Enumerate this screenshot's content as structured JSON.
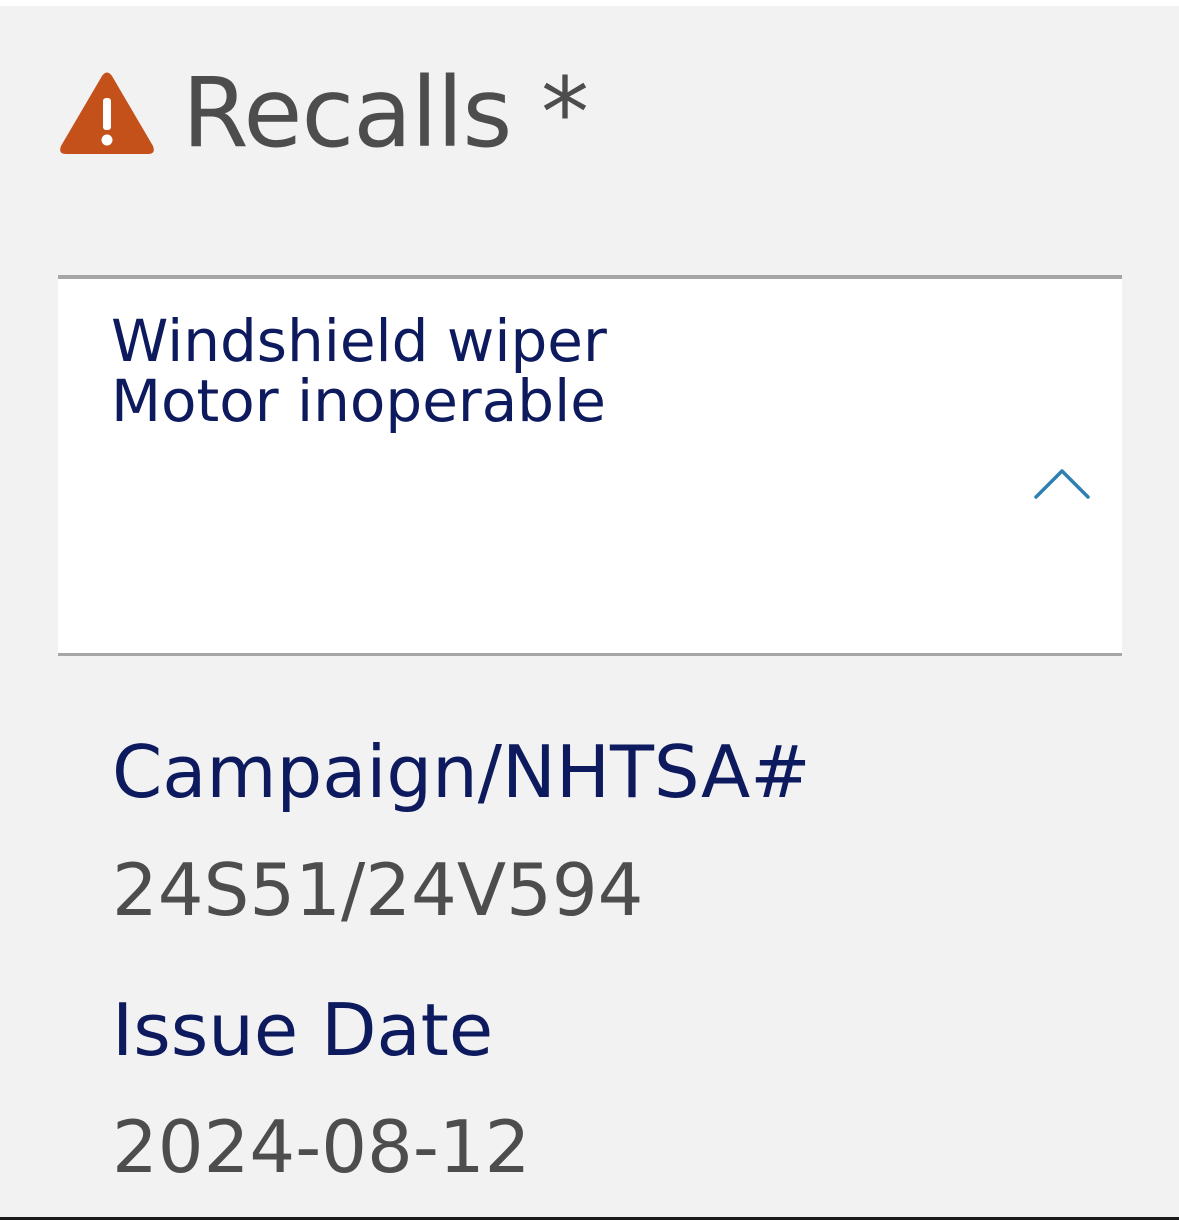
{
  "header": {
    "title": "Recalls *",
    "icon": "warning-triangle-icon",
    "icon_color": "#c4501a"
  },
  "recall": {
    "title_line1": "Windshield wiper",
    "title_line2": "Motor inoperable",
    "expanded": true,
    "toggle_icon": "chevron-up-icon",
    "toggle_color": "#2f7fb0"
  },
  "details": {
    "campaign_label": "Campaign/NHTSA#",
    "campaign_value": "24S51/24V594",
    "issue_date_label": "Issue Date",
    "issue_date_value": "2024-08-12"
  },
  "colors": {
    "label_text": "#0d1a5e",
    "value_text": "#4d4d4d",
    "background": "#f2f2f2"
  }
}
